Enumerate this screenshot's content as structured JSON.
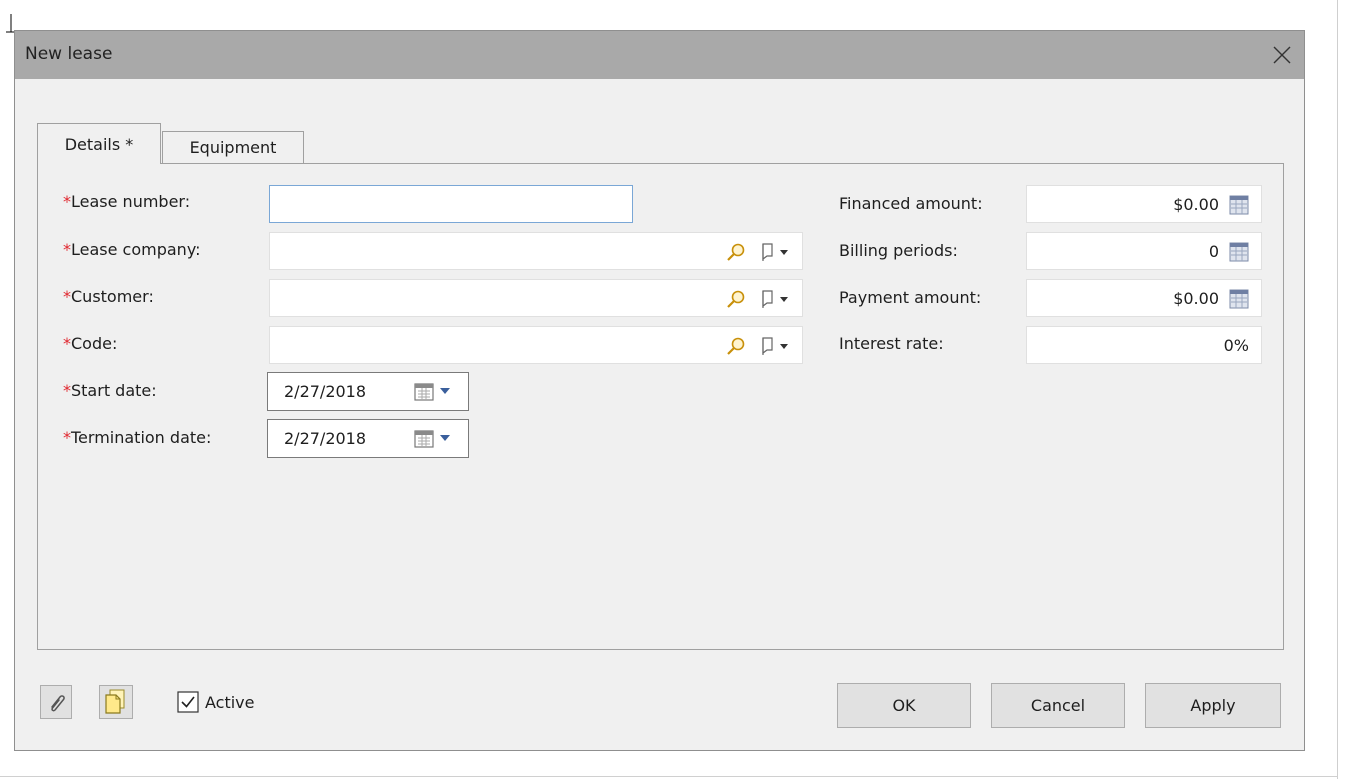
{
  "window": {
    "title": "New lease"
  },
  "tabs": [
    {
      "label": "Details *",
      "selected": true
    },
    {
      "label": "Equipment",
      "selected": false
    }
  ],
  "required_marker": "*",
  "left_fields": {
    "lease_number": {
      "label": "Lease number:",
      "value": ""
    },
    "lease_company": {
      "label": "Lease company:",
      "value": ""
    },
    "customer": {
      "label": "Customer:",
      "value": ""
    },
    "code": {
      "label": "Code:",
      "value": ""
    },
    "start_date": {
      "label": "Start date:",
      "value": "2/27/2018"
    },
    "termination_date": {
      "label": "Termination date:",
      "value": "2/27/2018"
    }
  },
  "right_fields": {
    "financed_amount": {
      "label": "Financed amount:",
      "value": "$0.00"
    },
    "billing_periods": {
      "label": "Billing periods:",
      "value": "0"
    },
    "payment_amount": {
      "label": "Payment amount:",
      "value": "$0.00"
    },
    "interest_rate": {
      "label": "Interest rate:",
      "value": "0%"
    }
  },
  "footer": {
    "active_label": "Active",
    "active_checked": true,
    "ok_label": "OK",
    "cancel_label": "Cancel",
    "apply_label": "Apply"
  },
  "icons": {
    "lookup": "magnifier-icon",
    "flag": "flag-dropdown-icon",
    "calendar": "calendar-icon",
    "calculator": "calculator-icon",
    "attach": "paperclip-icon",
    "notes": "notes-icon",
    "close": "close-icon"
  },
  "colors": {
    "required": "#e0262e",
    "titlebar": "#a9a9a9",
    "dialog_bg": "#f0f0f0"
  }
}
